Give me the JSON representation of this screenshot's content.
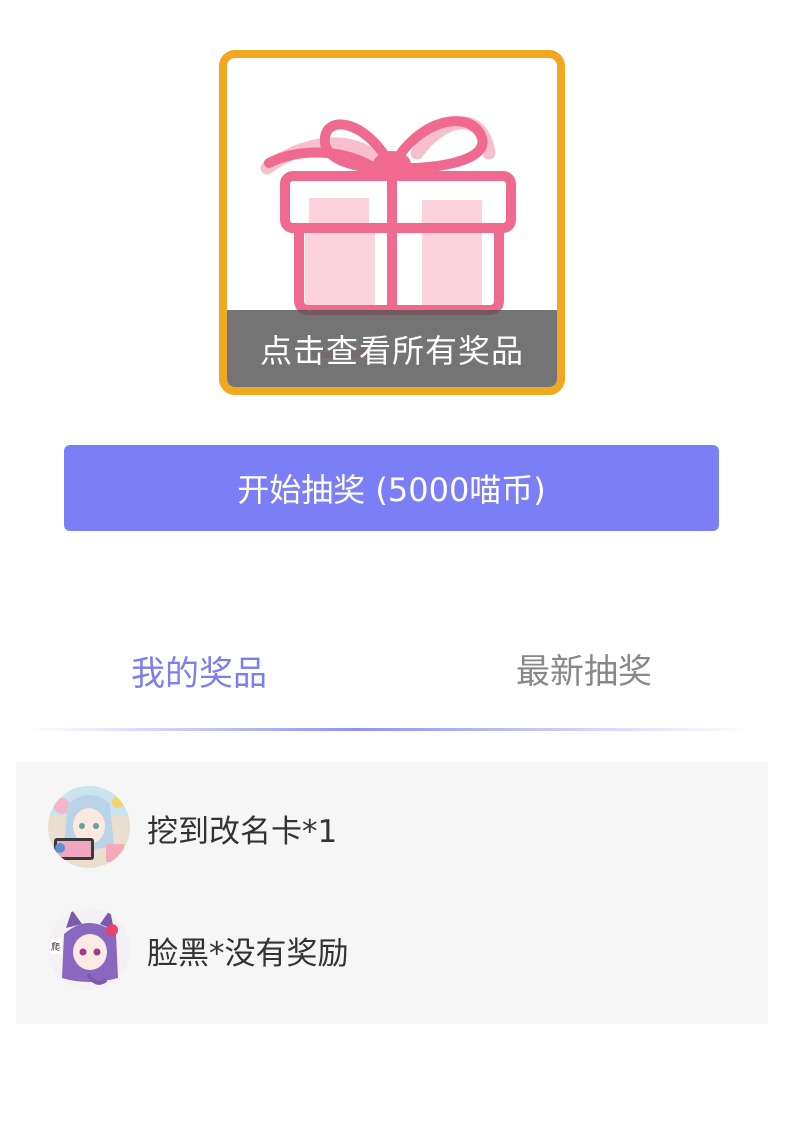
{
  "gift": {
    "overlay_label": "点击查看所有奖品",
    "icon": "gift-box-icon",
    "border_color": "#f0a820",
    "icon_color": "#f0608a"
  },
  "draw_button": {
    "label": "开始抽奖 (5000喵币)",
    "color": "#7b7ff5"
  },
  "tabs": [
    {
      "label": "我的奖品",
      "active": true
    },
    {
      "label": "最新抽奖",
      "active": false
    }
  ],
  "prizes": [
    {
      "text": "挖到改名卡*1",
      "avatar": "anime-girl-avatar"
    },
    {
      "text": "脸黑*没有奖励",
      "avatar": "anime-catgirl-avatar"
    }
  ]
}
